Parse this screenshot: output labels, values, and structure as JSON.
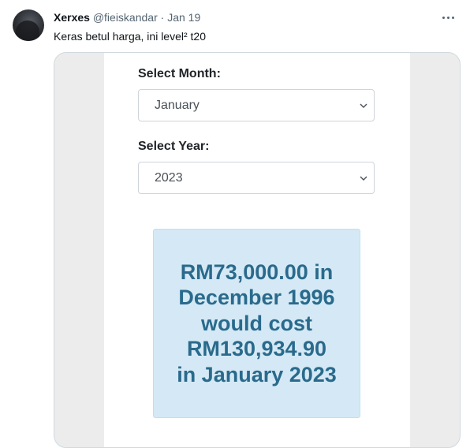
{
  "tweet": {
    "name": "Xerxes",
    "handle": "@fieiskandar",
    "separator": "·",
    "date": "Jan 19",
    "text": "Keras betul harga, ini level² t20"
  },
  "form": {
    "month_label": "Select Month:",
    "month_value": "January",
    "year_label": "Select Year:",
    "year_value": "2023"
  },
  "result": {
    "lines": [
      "RM73,000.00 in",
      "December 1996",
      "would cost",
      "RM130,934.90",
      "in January 2023"
    ]
  },
  "colors": {
    "result_bg": "#d4e9f5",
    "result_text": "#2a6a8c"
  },
  "icons": {
    "more": "more-horizontal-icon",
    "select_chevron": "chevron-down-icon"
  }
}
